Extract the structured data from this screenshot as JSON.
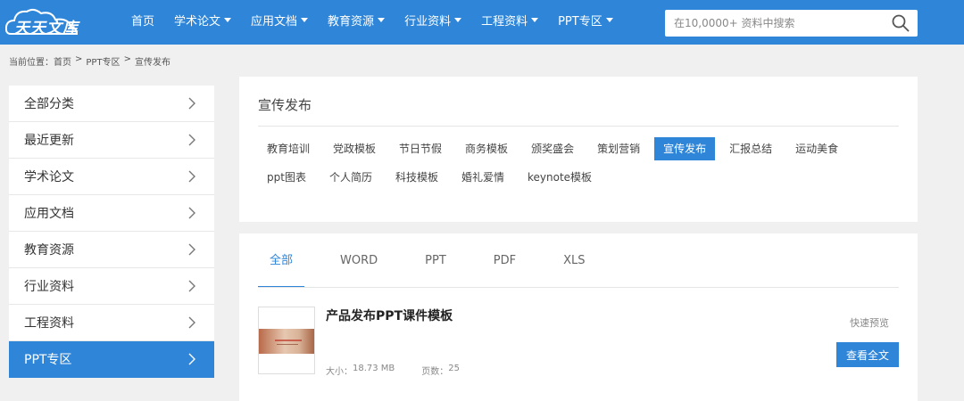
{
  "header": {
    "logo_text": "天天文库",
    "nav": [
      {
        "label": "首页",
        "dropdown": false
      },
      {
        "label": "学术论文",
        "dropdown": true
      },
      {
        "label": "应用文档",
        "dropdown": true
      },
      {
        "label": "教育资源",
        "dropdown": true
      },
      {
        "label": "行业资料",
        "dropdown": true
      },
      {
        "label": "工程资料",
        "dropdown": true
      },
      {
        "label": "PPT专区",
        "dropdown": true
      }
    ],
    "search_placeholder": "在10,0000+ 资料中搜索"
  },
  "breadcrumb": {
    "prefix": "当前位置：",
    "items": [
      "首页",
      "PPT专区",
      "宣传发布"
    ],
    "separator": ">"
  },
  "sidebar": {
    "items": [
      {
        "label": "全部分类",
        "active": false
      },
      {
        "label": "最近更新",
        "active": false
      },
      {
        "label": "学术论文",
        "active": false
      },
      {
        "label": "应用文档",
        "active": false
      },
      {
        "label": "教育资源",
        "active": false
      },
      {
        "label": "行业资料",
        "active": false
      },
      {
        "label": "工程资料",
        "active": false
      },
      {
        "label": "PPT专区",
        "active": true
      }
    ]
  },
  "category": {
    "title": "宣传发布",
    "rows": [
      [
        {
          "label": "教育培训",
          "active": false
        },
        {
          "label": "党政模板",
          "active": false
        },
        {
          "label": "节日节假",
          "active": false
        },
        {
          "label": "商务模板",
          "active": false
        },
        {
          "label": "颁奖盛会",
          "active": false
        },
        {
          "label": "策划营销",
          "active": false
        },
        {
          "label": "宣传发布",
          "active": true
        },
        {
          "label": "汇报总结",
          "active": false
        },
        {
          "label": "运动美食",
          "active": false
        }
      ],
      [
        {
          "label": "ppt图表",
          "active": false
        },
        {
          "label": "个人简历",
          "active": false
        },
        {
          "label": "科技模板",
          "active": false
        },
        {
          "label": "婚礼爱情",
          "active": false
        },
        {
          "label": "keynote模板",
          "active": false
        }
      ]
    ]
  },
  "doc_tabs": [
    {
      "label": "全部",
      "active": true
    },
    {
      "label": "WORD",
      "active": false
    },
    {
      "label": "PPT",
      "active": false
    },
    {
      "label": "PDF",
      "active": false
    },
    {
      "label": "XLS",
      "active": false
    }
  ],
  "documents": [
    {
      "title": "产品发布PPT课件模板",
      "size_label": "大小：",
      "size": "18.73 MB",
      "pages_label": "页数：",
      "pages": "25",
      "preview_label": "快速预览",
      "view_label": "查看全文"
    }
  ],
  "colors": {
    "brand": "#2f86d9",
    "background": "#f0f0f0"
  }
}
